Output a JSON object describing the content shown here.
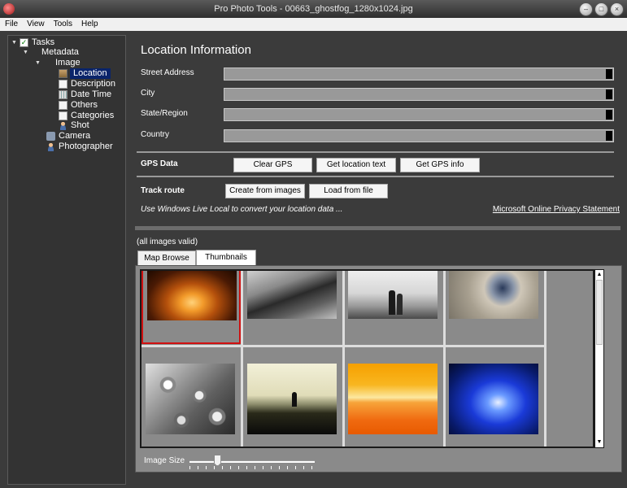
{
  "window": {
    "title": "Pro Photo Tools - 00663_ghostfog_1280x1024.jpg"
  },
  "menu": [
    "File",
    "View",
    "Tools",
    "Help"
  ],
  "sidebar": {
    "items": [
      {
        "label": "Tasks",
        "icon": "checklist-icon",
        "twisty": "expanded"
      },
      {
        "label": "Metadata",
        "icon": "",
        "twisty": "expanded"
      },
      {
        "label": "Image",
        "icon": "",
        "twisty": "expanded"
      },
      {
        "label": "Location",
        "icon": "location-icon",
        "selected": true
      },
      {
        "label": "Description",
        "icon": "page-icon"
      },
      {
        "label": "Date Time",
        "icon": "calendar-icon"
      },
      {
        "label": "Others",
        "icon": "page-icon"
      },
      {
        "label": "Categories",
        "icon": "page-icon"
      },
      {
        "label": "Shot",
        "icon": "person-icon"
      },
      {
        "label": "Camera",
        "icon": "camera-icon"
      },
      {
        "label": "Photographer",
        "icon": "person-icon"
      }
    ]
  },
  "location": {
    "heading": "Location Information",
    "fields": [
      {
        "label": "Street Address",
        "value": ""
      },
      {
        "label": "City",
        "value": ""
      },
      {
        "label": "State/Region",
        "value": ""
      },
      {
        "label": "Country",
        "value": ""
      }
    ]
  },
  "gps": {
    "label": "GPS Data",
    "clear": "Clear GPS",
    "get_text": "Get location text",
    "get_info": "Get GPS info"
  },
  "track": {
    "label": "Track route",
    "create": "Create from images",
    "load": "Load from file"
  },
  "note": "Use Windows Live Local to convert your location data ...",
  "privacy": "Microsoft Online Privacy Statement",
  "images_status": "(all images valid)",
  "tabs": [
    {
      "label": "Map Browse",
      "active": false
    },
    {
      "label": "Thumbnails",
      "active": true
    }
  ],
  "thumbnails": [
    {
      "name": "ghostfog-forest",
      "selected": true
    },
    {
      "name": "railing-path"
    },
    {
      "name": "couple-foggy-beach"
    },
    {
      "name": "spiral-metal"
    },
    {
      "name": "water-droplets"
    },
    {
      "name": "lone-figure-field"
    },
    {
      "name": "orange-sunset-gradient"
    },
    {
      "name": "blue-light-swirl"
    }
  ],
  "image_size": {
    "label": "Image Size",
    "level": 0.22
  }
}
